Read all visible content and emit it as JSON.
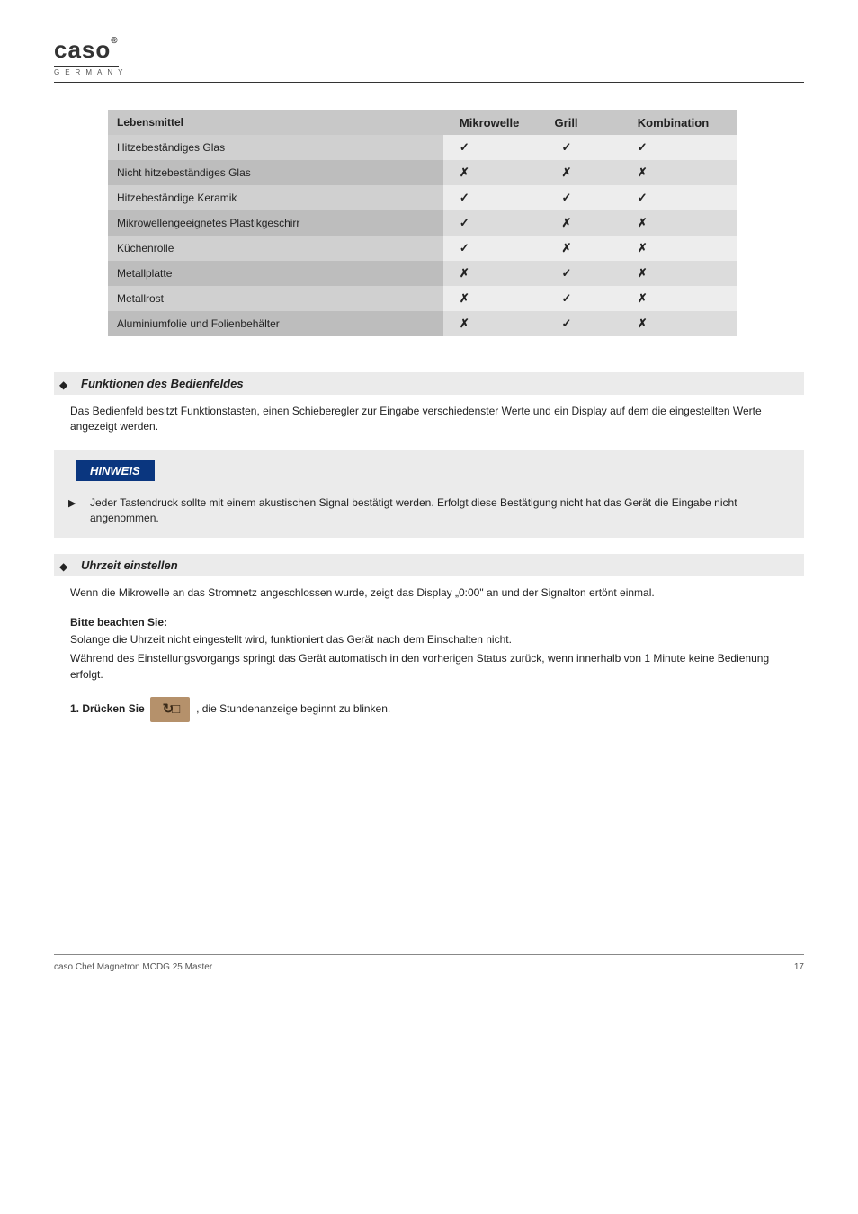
{
  "logo": {
    "brand": "caso",
    "reg": "®",
    "sub": "GERMANY"
  },
  "table": {
    "headers": [
      "Lebensmittel",
      "Mikrowelle",
      "Grill",
      "Kombination"
    ],
    "rows": [
      {
        "name": "Hitzebeständiges Glas",
        "v": [
          "✓",
          "✓",
          "✓"
        ]
      },
      {
        "name": "Nicht hitzebeständiges Glas",
        "v": [
          "✗",
          "✗",
          "✗"
        ]
      },
      {
        "name": "Hitzebeständige Keramik",
        "v": [
          "✓",
          "✓",
          "✓"
        ]
      },
      {
        "name": "Mikrowellengeeignetes Plastikgeschirr",
        "v": [
          "✓",
          "✗",
          "✗"
        ]
      },
      {
        "name": "Küchenrolle",
        "v": [
          "✓",
          "✗",
          "✗"
        ]
      },
      {
        "name": "Metallplatte",
        "v": [
          "✗",
          "✓",
          "✗"
        ]
      },
      {
        "name": "Metallrost",
        "v": [
          "✗",
          "✓",
          "✗"
        ]
      },
      {
        "name": "Aluminiumfolie und Folienbehälter",
        "v": [
          "✗",
          "✓",
          "✗"
        ]
      }
    ]
  },
  "sec1": {
    "title": "Funktionen des Bedienfeldes",
    "body": "Das Bedienfeld besitzt Funktionstasten, einen Schieberegler zur Eingabe verschiedenster Werte und ein Display auf dem die eingestellten Werte angezeigt werden."
  },
  "hinweis": {
    "label": "HINWEIS",
    "item": "Jeder Tastendruck sollte mit einem akustischen Signal bestätigt werden. Erfolgt diese Bestätigung nicht hat das Gerät die Eingabe nicht angenommen."
  },
  "sec2": {
    "title": "Uhrzeit einstellen",
    "body1": "Wenn die Mikrowelle an das Stromnetz angeschlossen wurde, zeigt das Display „0:00\" an und der Signalton ertönt einmal.",
    "sub": "Bitte beachten Sie:",
    "body2line1": "Solange die Uhrzeit nicht eingestellt wird, funktioniert das Gerät nach dem Einschalten nicht.",
    "body2line2": "Während des Einstellungsvorgangs springt das Gerät automatisch in den vorherigen Status zurück, wenn innerhalb von 1 Minute keine Bedienung erfolgt.",
    "step1": "1. Drücken Sie",
    "step1b": ", die Stundenanzeige beginnt zu blinken."
  },
  "footer": {
    "left": "caso Chef Magnetron MCDG 25 Master",
    "right": "17"
  }
}
